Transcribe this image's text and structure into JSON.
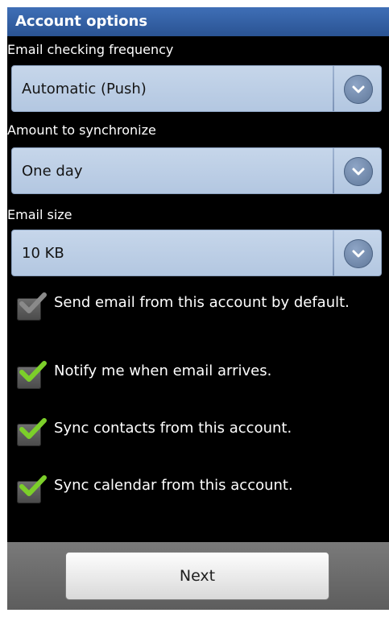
{
  "header": {
    "title": "Account options"
  },
  "sections": [
    {
      "label": "Email checking frequency",
      "value": "Automatic (Push)"
    },
    {
      "label": "Amount to synchronize",
      "value": "One day"
    },
    {
      "label": "Email size",
      "value": "10 KB"
    }
  ],
  "checkboxes": [
    {
      "label": "Send email from this account by default.",
      "checked": true,
      "enabled": false
    },
    {
      "label": "Notify me when email arrives.",
      "checked": true,
      "enabled": true
    },
    {
      "label": "Sync contacts from this account.",
      "checked": true,
      "enabled": true
    },
    {
      "label": "Sync calendar from this account.",
      "checked": true,
      "enabled": true
    }
  ],
  "footer": {
    "next_label": "Next"
  },
  "colors": {
    "title_bar": "#2f5ea3",
    "dropdown": "#bfd0e6",
    "check_active": "#7ccf2a",
    "check_disabled": "#8a8a8a",
    "background": "#000000"
  }
}
